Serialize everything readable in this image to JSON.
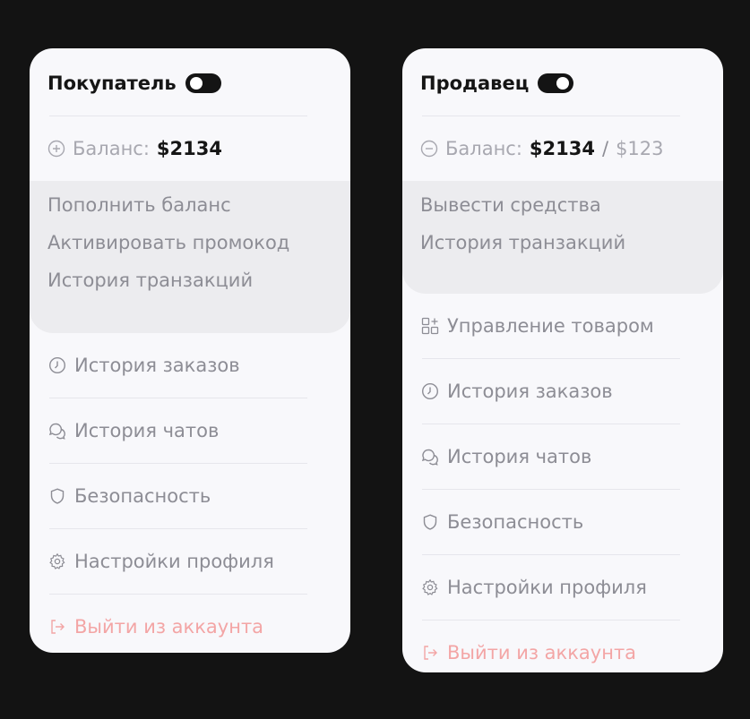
{
  "buyer": {
    "title": "Покупатель",
    "toggle_state": "off",
    "balance_label": "Баланс:",
    "balance_value": "$2134",
    "submenu": [
      "Пополнить баланс",
      "Активировать промокод",
      "История транзакций"
    ],
    "menu": [
      {
        "icon": "clock-icon",
        "label": "История заказов"
      },
      {
        "icon": "chat-icon",
        "label": "История чатов"
      },
      {
        "icon": "shield-icon",
        "label": "Безопасность"
      },
      {
        "icon": "gear-icon",
        "label": "Настройки профиля"
      }
    ],
    "logout_label": "Выйти из аккаунта"
  },
  "seller": {
    "title": "Продавец",
    "toggle_state": "on",
    "balance_label": "Баланс:",
    "balance_value": "$2134",
    "balance_separator": "/",
    "balance_secondary": "$123",
    "submenu": [
      "Вывести средства",
      "История транзакций"
    ],
    "menu": [
      {
        "icon": "grid-plus-icon",
        "label": "Управление товаром"
      },
      {
        "icon": "clock-icon",
        "label": "История заказов"
      },
      {
        "icon": "chat-icon",
        "label": "История чатов"
      },
      {
        "icon": "shield-icon",
        "label": "Безопасность"
      },
      {
        "icon": "gear-icon",
        "label": "Настройки профиля"
      }
    ],
    "logout_label": "Выйти из аккаунта"
  },
  "colors": {
    "background": "#131313",
    "card": "#f8f8fb",
    "submenu_bg": "#ececef",
    "text_primary": "#151515",
    "text_muted": "#8d8d95",
    "logout": "#f3a5a5"
  }
}
